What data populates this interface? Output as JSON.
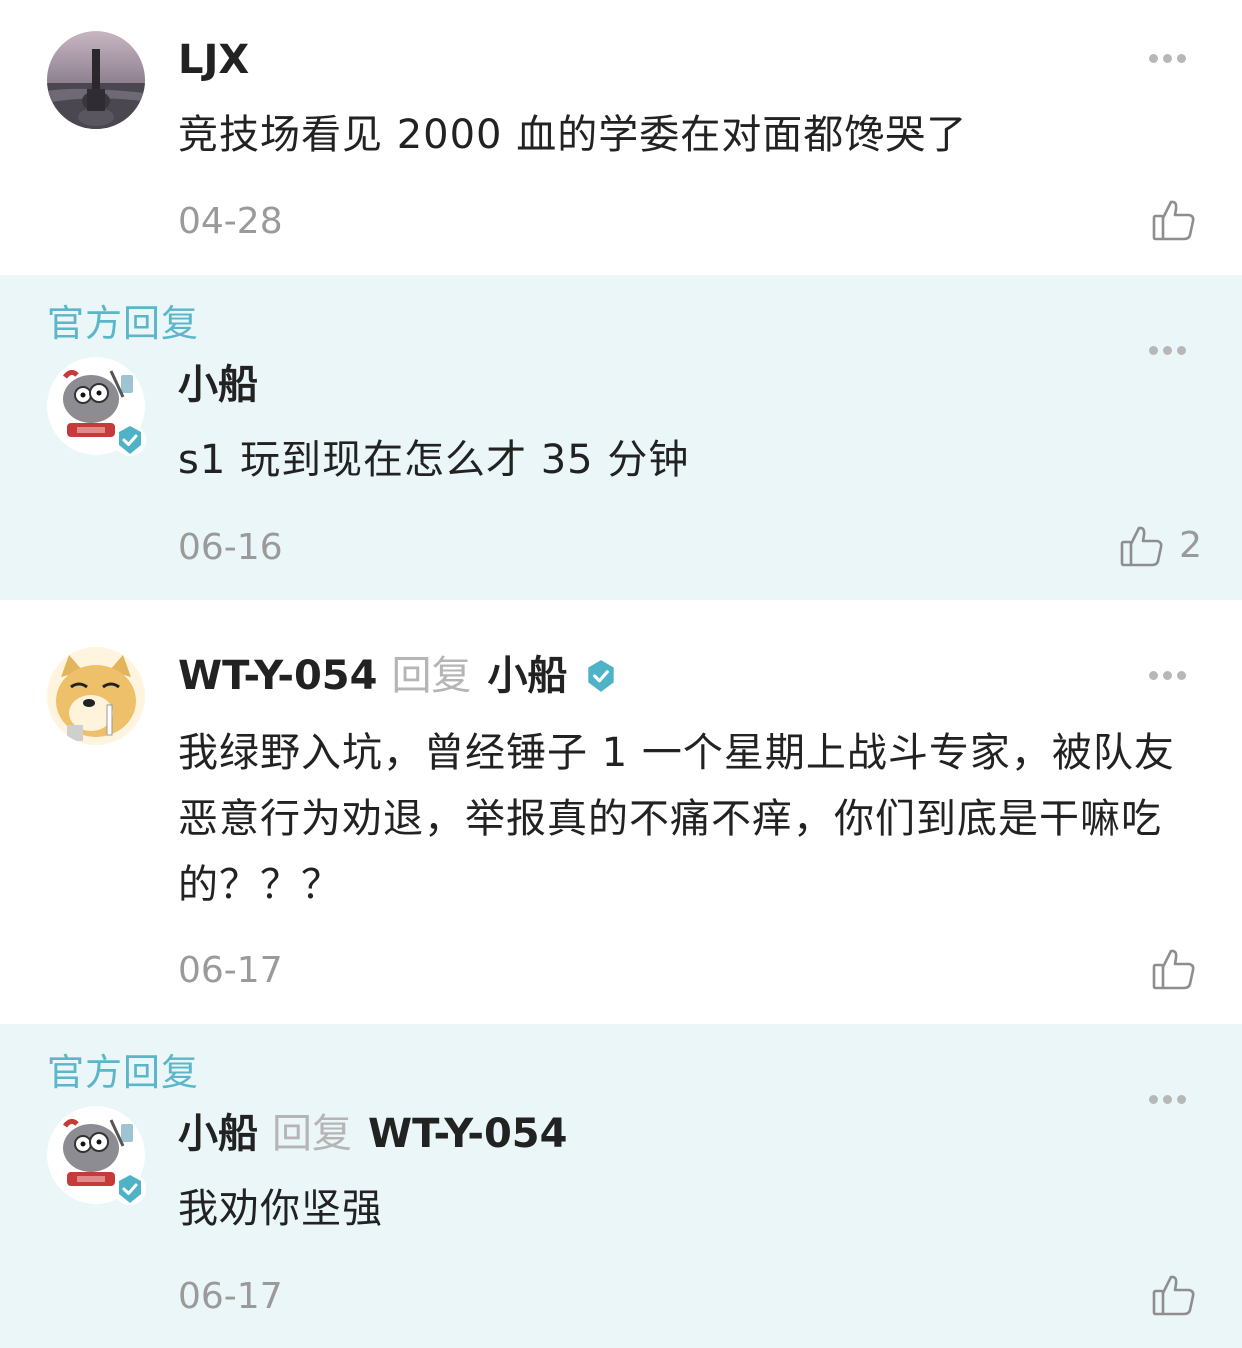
{
  "comments": [
    {
      "official": false,
      "official_label": "",
      "author": "LJX",
      "reply_word": "",
      "reply_to": "",
      "text": "竞技场看见 2000 血的学委在对面都馋哭了",
      "date": "04-28",
      "likes": ""
    },
    {
      "official": true,
      "official_label": "官方回复",
      "author": "小船",
      "reply_word": "",
      "reply_to": "",
      "text": "s1 玩到现在怎么才 35 分钟",
      "date": "06-16",
      "likes": "2"
    },
    {
      "official": false,
      "official_label": "",
      "author": "WT-Y-054",
      "reply_word": "回复",
      "reply_to": "小船",
      "text": "我绿野入坑，曾经锤子 1 一个星期上战斗专家，被队友恶意行为劝退，举报真的不痛不痒，你们到底是干嘛吃的？？？",
      "date": "06-17",
      "likes": ""
    },
    {
      "official": true,
      "official_label": "官方回复",
      "author": "小船",
      "reply_word": "回复",
      "reply_to": "WT-Y-054",
      "text": "我劝你坚强",
      "date": "06-17",
      "likes": ""
    }
  ],
  "icons": {
    "more": "more-dots-icon",
    "like": "thumbs-up-icon",
    "verified": "verified-badge-icon"
  },
  "colors": {
    "official_bg": "#eaf6f8",
    "official_label": "#5bb6c9",
    "verified_badge": "#4fb3c8",
    "meta_text": "#9a9a9a"
  }
}
